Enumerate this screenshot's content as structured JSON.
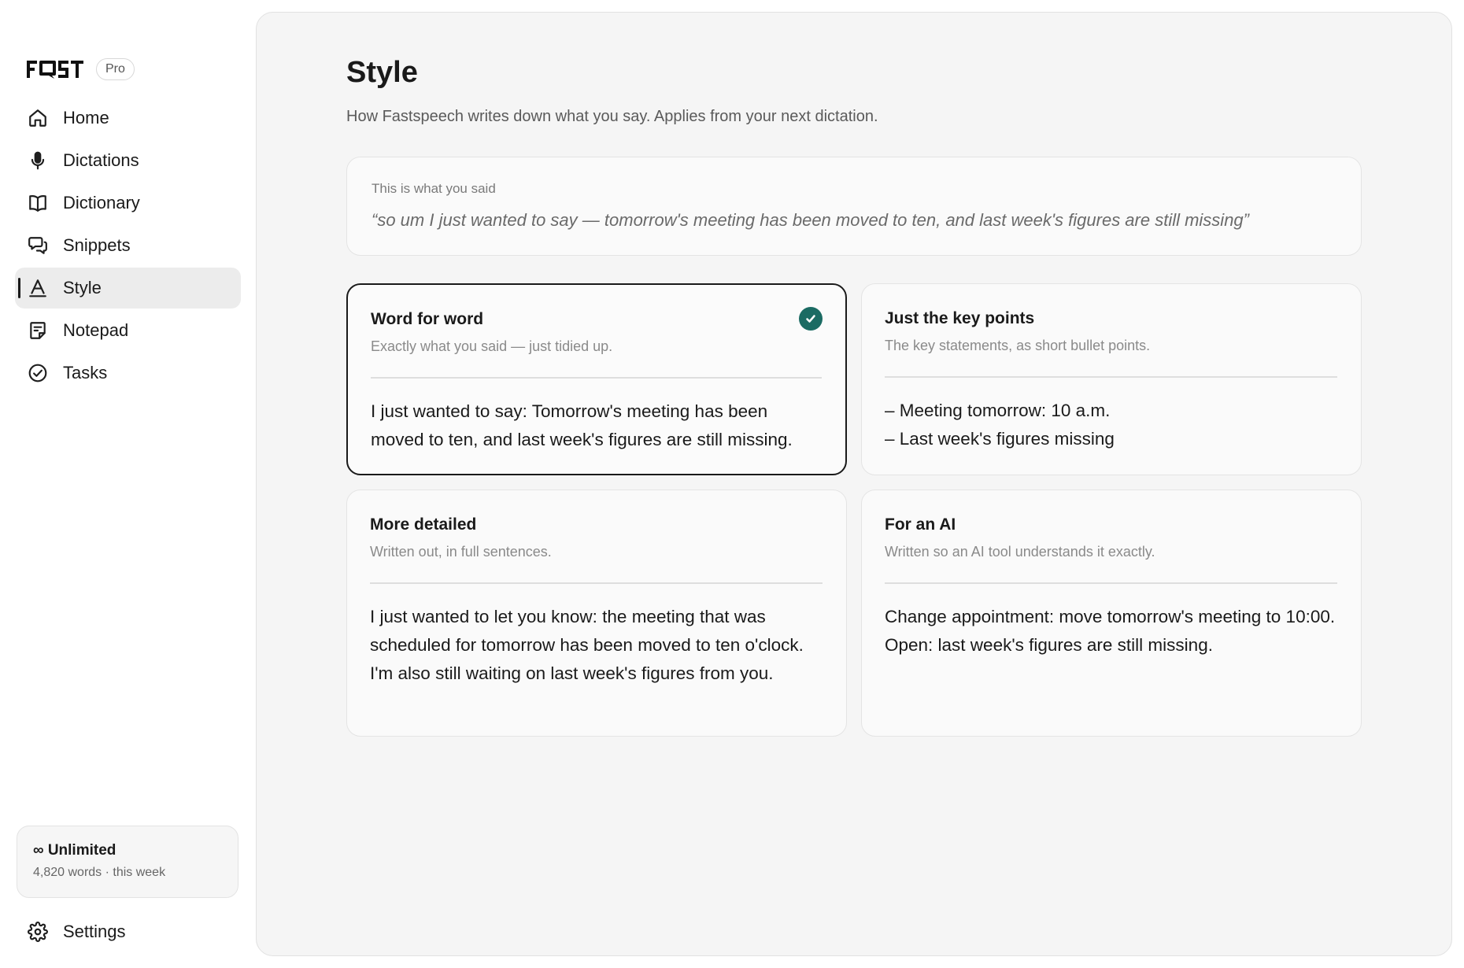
{
  "brand": {
    "logo_text": "FAST",
    "badge": "Pro"
  },
  "sidebar": {
    "items": [
      {
        "label": "Home",
        "icon": "home-icon",
        "active": false
      },
      {
        "label": "Dictations",
        "icon": "microphone-icon",
        "active": false
      },
      {
        "label": "Dictionary",
        "icon": "book-icon",
        "active": false
      },
      {
        "label": "Snippets",
        "icon": "snippets-icon",
        "active": false
      },
      {
        "label": "Style",
        "icon": "style-icon",
        "active": true
      },
      {
        "label": "Notepad",
        "icon": "notepad-icon",
        "active": false
      },
      {
        "label": "Tasks",
        "icon": "check-circle-icon",
        "active": false
      }
    ],
    "usage": {
      "title": "∞ Unlimited",
      "subtitle": "4,820 words · this week"
    },
    "settings": {
      "label": "Settings",
      "icon": "gear-icon"
    }
  },
  "main": {
    "title": "Style",
    "subtitle": "How Fastspeech writes down what you say. Applies from your next dictation.",
    "quote": {
      "label": "This is what you said",
      "text": "“so um I just wanted to say — tomorrow's meeting has been moved to ten, and last week's figures are still missing”"
    },
    "styles": [
      {
        "title": "Word for word",
        "description": "Exactly what you said — just tidied up.",
        "example": "I just wanted to say: Tomorrow's meeting has been moved to ten, and last week's figures are still missing.",
        "selected": true
      },
      {
        "title": "Just the key points",
        "description": "The key statements, as short bullet points.",
        "example": "– Meeting tomorrow: 10 a.m.\n– Last week's figures missing",
        "selected": false
      },
      {
        "title": "More detailed",
        "description": "Written out, in full sentences.",
        "example": "I just wanted to let you know: the meeting that was scheduled for tomorrow has been moved to ten o'clock. I'm also still waiting on last week's figures from you.",
        "selected": false
      },
      {
        "title": "For an AI",
        "description": "Written so an AI tool understands it exactly.",
        "example": "Change appointment: move tomorrow's meeting to 10:00.\nOpen: last week's figures are still missing.",
        "selected": false
      }
    ]
  },
  "colors": {
    "accent": "#1b6b63",
    "active_nav": "#ececec",
    "panel": "#f5f5f5"
  }
}
